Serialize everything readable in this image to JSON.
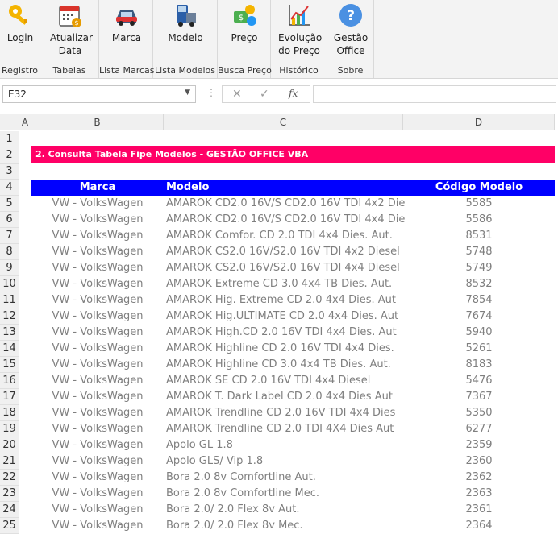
{
  "ribbon": {
    "groups": [
      {
        "label": "Registro",
        "buttons": [
          {
            "label": "Login",
            "icon": "key-icon"
          }
        ]
      },
      {
        "label": "Tabelas",
        "buttons": [
          {
            "label": "Atualizar\nData",
            "icon": "calendar-icon"
          }
        ]
      },
      {
        "label": "Lista Marcas",
        "buttons": [
          {
            "label": "Marca",
            "icon": "car-icon"
          }
        ]
      },
      {
        "label": "Lista Modelos",
        "buttons": [
          {
            "label": "Modelo",
            "icon": "truck-icon"
          }
        ]
      },
      {
        "label": "Busca Preço",
        "buttons": [
          {
            "label": "Preço",
            "icon": "money-icon"
          }
        ]
      },
      {
        "label": "Histórico",
        "buttons": [
          {
            "label": "Evolução\ndo Preço",
            "icon": "chart-icon"
          }
        ]
      },
      {
        "label": "Sobre",
        "buttons": [
          {
            "label": "Gestão\nOffice",
            "icon": "help-icon"
          }
        ]
      }
    ]
  },
  "formula_bar": {
    "name_box": "E32",
    "fx": "fx",
    "value": ""
  },
  "columns": [
    "A",
    "B",
    "C",
    "D"
  ],
  "rows": [
    "1",
    "2",
    "3",
    "4",
    "5",
    "6",
    "7",
    "8",
    "9",
    "10",
    "11",
    "12",
    "13",
    "14",
    "15",
    "16",
    "17",
    "18",
    "19",
    "20",
    "21",
    "22",
    "23",
    "24",
    "25"
  ],
  "sheet": {
    "title": "2. Consulta Tabela Fipe Modelos - GESTÃO OFFICE VBA",
    "headers": {
      "marca": "Marca",
      "modelo": "Modelo",
      "codigo": "Código Modelo"
    },
    "data": [
      [
        "VW - VolksWagen",
        "AMAROK CD2.0 16V/S CD2.0 16V TDI 4x2 Die",
        "5585"
      ],
      [
        "VW - VolksWagen",
        "AMAROK CD2.0 16V/S CD2.0 16V TDI 4x4 Die",
        "5586"
      ],
      [
        "VW - VolksWagen",
        "AMAROK Comfor. CD 2.0 TDI 4x4 Dies. Aut.",
        "8531"
      ],
      [
        "VW - VolksWagen",
        "AMAROK CS2.0 16V/S2.0 16V TDI 4x2 Diesel",
        "5748"
      ],
      [
        "VW - VolksWagen",
        "AMAROK CS2.0 16V/S2.0 16V TDI 4x4 Diesel",
        "5749"
      ],
      [
        "VW - VolksWagen",
        "AMAROK Extreme CD 3.0 4x4 TB Dies. Aut.",
        "8532"
      ],
      [
        "VW - VolksWagen",
        "AMAROK Hig. Extreme CD 2.0 4x4 Dies. Aut",
        "7854"
      ],
      [
        "VW - VolksWagen",
        "AMAROK Hig.ULTIMATE CD 2.0 4x4 Dies. Aut",
        "7674"
      ],
      [
        "VW - VolksWagen",
        "AMAROK High.CD 2.0 16V TDI 4x4 Dies. Aut",
        "5940"
      ],
      [
        "VW - VolksWagen",
        "AMAROK Highline CD 2.0 16V TDI 4x4 Dies.",
        "5261"
      ],
      [
        "VW - VolksWagen",
        "AMAROK Highline CD 3.0 4x4 TB Dies. Aut.",
        "8183"
      ],
      [
        "VW - VolksWagen",
        "AMAROK SE CD 2.0 16V TDI 4x4 Diesel",
        "5476"
      ],
      [
        "VW - VolksWagen",
        "AMAROK T. Dark Label CD 2.0 4x4 Dies Aut",
        "7367"
      ],
      [
        "VW - VolksWagen",
        "AMAROK Trendline CD 2.0 16V TDI 4x4 Dies",
        "5350"
      ],
      [
        "VW - VolksWagen",
        "AMAROK Trendline CD 2.0 TDI 4X4 Dies Aut",
        "6277"
      ],
      [
        "VW - VolksWagen",
        "Apolo GL 1.8",
        "2359"
      ],
      [
        "VW - VolksWagen",
        "Apolo GLS/ Vip 1.8",
        "2360"
      ],
      [
        "VW - VolksWagen",
        "Bora 2.0 8v Comfortline Aut.",
        "2362"
      ],
      [
        "VW - VolksWagen",
        "Bora 2.0 8v Comfortline Mec.",
        "2363"
      ],
      [
        "VW - VolksWagen",
        "Bora 2.0/ 2.0 Flex 8v Aut.",
        "2361"
      ],
      [
        "VW - VolksWagen",
        "Bora 2.0/ 2.0 Flex 8v Mec.",
        "2364"
      ]
    ]
  },
  "colors": {
    "title_bg": "#ff0066",
    "header_bg": "#0000ff",
    "data_text": "#7f7f7f"
  }
}
